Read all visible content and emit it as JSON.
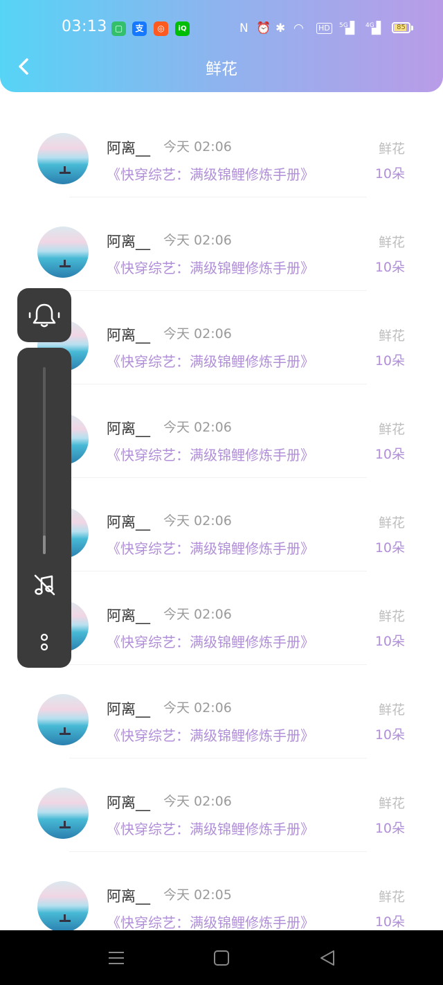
{
  "status_bar": {
    "time": "03:13",
    "apps": [
      {
        "icon": "green-app-icon",
        "color": "#34c06b",
        "glyph": "▢"
      },
      {
        "icon": "alipay-icon",
        "color": "#1677ff",
        "glyph": "支"
      },
      {
        "icon": "orange-app-icon",
        "color": "#ff5a1f",
        "glyph": "◎"
      },
      {
        "icon": "iqiyi-icon",
        "color": "#00be06",
        "glyph": "iQ"
      }
    ],
    "network_labels": [
      "HD",
      "5G",
      "4G"
    ],
    "battery_level": "85",
    "battery_fraction": 0.85
  },
  "header": {
    "title": "鲜花"
  },
  "items": [
    {
      "name": "阿离__",
      "time": "今天 02:06",
      "book": "《快穿综艺：满级锦鲤修炼手册》",
      "gift_type": "鲜花",
      "gift_count": "10朵"
    },
    {
      "name": "阿离__",
      "time": "今天 02:06",
      "book": "《快穿综艺：满级锦鲤修炼手册》",
      "gift_type": "鲜花",
      "gift_count": "10朵"
    },
    {
      "name": "阿离__",
      "time": "今天 02:06",
      "book": "《快穿综艺：满级锦鲤修炼手册》",
      "gift_type": "鲜花",
      "gift_count": "10朵"
    },
    {
      "name": "阿离__",
      "time": "今天 02:06",
      "book": "《快穿综艺：满级锦鲤修炼手册》",
      "gift_type": "鲜花",
      "gift_count": "10朵"
    },
    {
      "name": "阿离__",
      "time": "今天 02:06",
      "book": "《快穿综艺：满级锦鲤修炼手册》",
      "gift_type": "鲜花",
      "gift_count": "10朵"
    },
    {
      "name": "阿离__",
      "time": "今天 02:06",
      "book": "《快穿综艺：满级锦鲤修炼手册》",
      "gift_type": "鲜花",
      "gift_count": "10朵"
    },
    {
      "name": "阿离__",
      "time": "今天 02:06",
      "book": "《快穿综艺：满级锦鲤修炼手册》",
      "gift_type": "鲜花",
      "gift_count": "10朵"
    },
    {
      "name": "阿离__",
      "time": "今天 02:06",
      "book": "《快穿综艺：满级锦鲤修炼手册》",
      "gift_type": "鲜花",
      "gift_count": "10朵"
    },
    {
      "name": "阿离__",
      "time": "今天 02:05",
      "book": "《快穿综艺：满级锦鲤修炼手册》",
      "gift_type": "鲜花",
      "gift_count": "10朵"
    }
  ],
  "volume_panel": {
    "volume_fraction": 0.1
  },
  "colors": {
    "accent": "#b18fd8",
    "header_start": "#56d4f6",
    "header_end": "#b99ce8"
  }
}
